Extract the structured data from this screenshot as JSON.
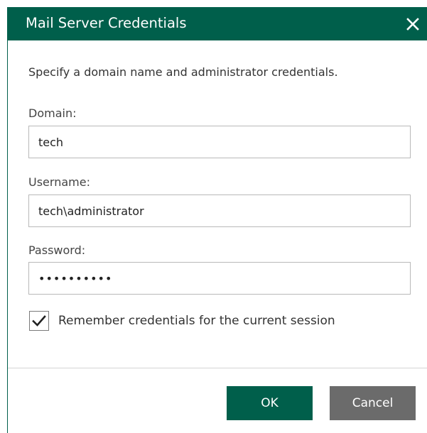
{
  "dialog": {
    "title": "Mail Server Credentials",
    "close_icon": "close-icon",
    "instruction": "Specify a domain name and administrator credentials."
  },
  "fields": {
    "domain": {
      "label": "Domain:",
      "value": "tech"
    },
    "username": {
      "label": "Username:",
      "value": "tech\\administrator"
    },
    "password": {
      "label": "Password:",
      "value": "••••••••••",
      "masked_length": 10
    }
  },
  "remember": {
    "label": "Remember credentials for the current session",
    "checked": true,
    "icon": "checkmark-icon"
  },
  "buttons": {
    "ok": "OK",
    "cancel": "Cancel"
  },
  "colors": {
    "accent": "#005f4b",
    "cancel_button": "#6b6b6b",
    "input_border": "#b9b9b9"
  }
}
